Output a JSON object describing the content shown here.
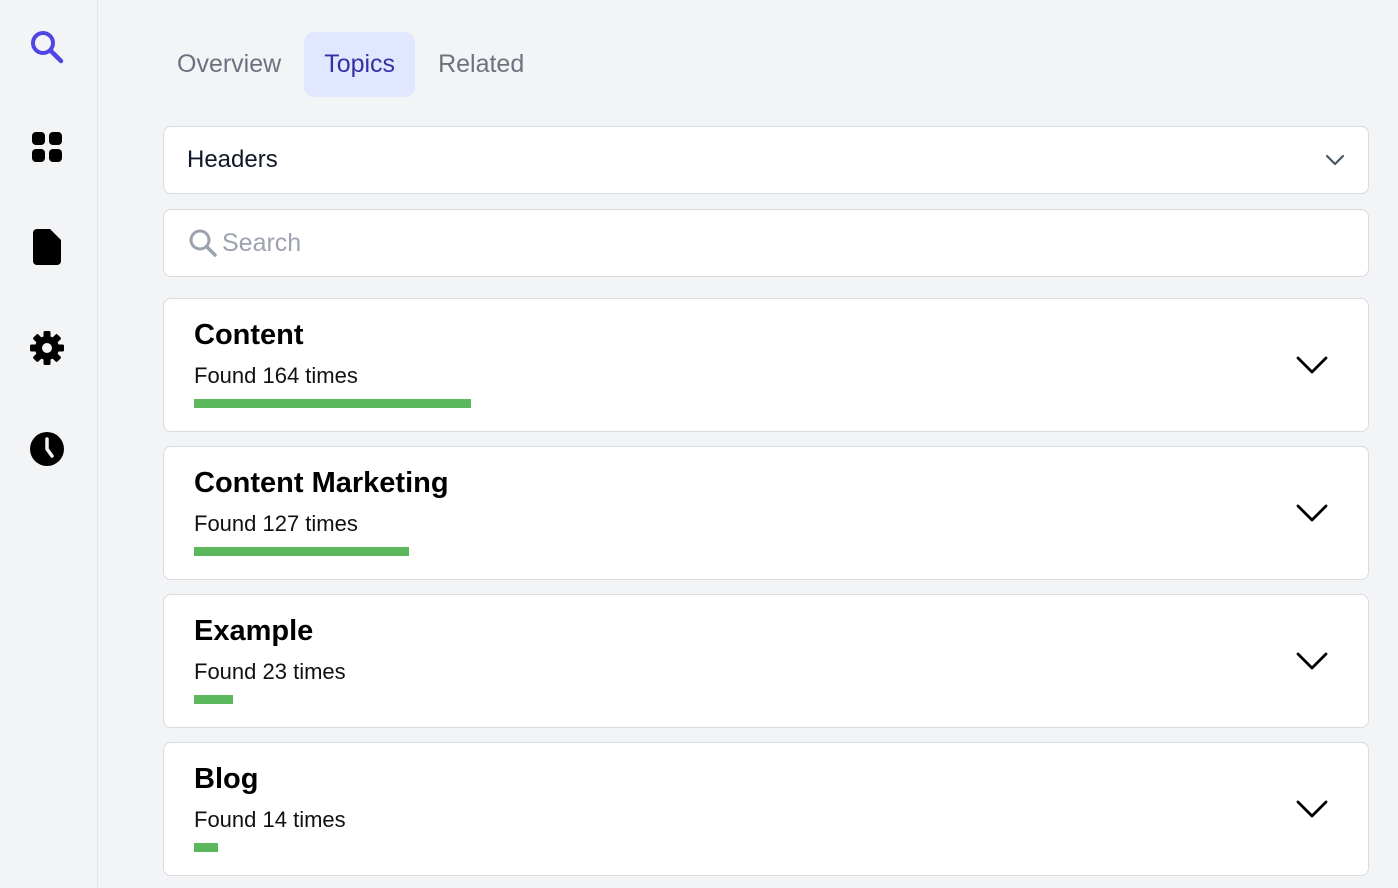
{
  "sidebar": {
    "items": [
      {
        "icon": "search-icon",
        "color": "#4f46e5"
      },
      {
        "icon": "dashboard-icon",
        "color": "#000000"
      },
      {
        "icon": "document-icon",
        "color": "#000000"
      },
      {
        "icon": "gear-icon",
        "color": "#000000"
      },
      {
        "icon": "clock-icon",
        "color": "#000000"
      }
    ]
  },
  "tabs": [
    {
      "label": "Overview",
      "active": false
    },
    {
      "label": "Topics",
      "active": true
    },
    {
      "label": "Related",
      "active": false
    }
  ],
  "filter": {
    "selected": "Headers",
    "icon": "chevron-down-icon"
  },
  "search": {
    "placeholder": "Search",
    "value": ""
  },
  "topics": [
    {
      "title": "Content",
      "count_label": "Found 164 times",
      "count": 164
    },
    {
      "title": "Content Marketing",
      "count_label": "Found 127 times",
      "count": 127
    },
    {
      "title": "Example",
      "count_label": "Found 23 times",
      "count": 23
    },
    {
      "title": "Blog",
      "count_label": "Found 14 times",
      "count": 14
    }
  ],
  "colors": {
    "accent": "#4f46e5",
    "active_tab_bg": "#e0e7ff",
    "active_tab_text": "#3730a3",
    "bar": "#5cb85c",
    "background": "#f3f4f6"
  }
}
